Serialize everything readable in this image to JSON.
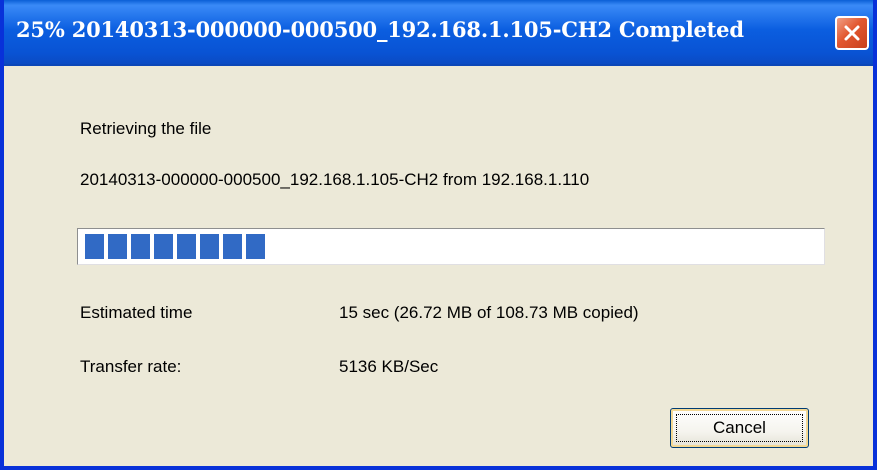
{
  "window": {
    "title": "25% 20140313-000000-000500_192.168.1.105-CH2 Completed"
  },
  "dialog": {
    "status_line": "Retrieving the file",
    "file_line": "20140313-000000-000500_192.168.1.105-CH2 from 192.168.1.110",
    "progress_fraction": 0.25,
    "estimated_time_label": "Estimated time",
    "estimated_time_value": "15 sec (26.72 MB of 108.73 MB copied)",
    "transfer_rate_label": "Transfer rate:",
    "transfer_rate_value": "5136 KB/Sec",
    "cancel_label": "Cancel"
  },
  "colors": {
    "titlebar": "#0b5ee0",
    "progress_block": "#316ac5",
    "close_button": "#e2572f",
    "dialog_background": "#ece9d8"
  },
  "icons": {
    "close": "close-icon"
  }
}
